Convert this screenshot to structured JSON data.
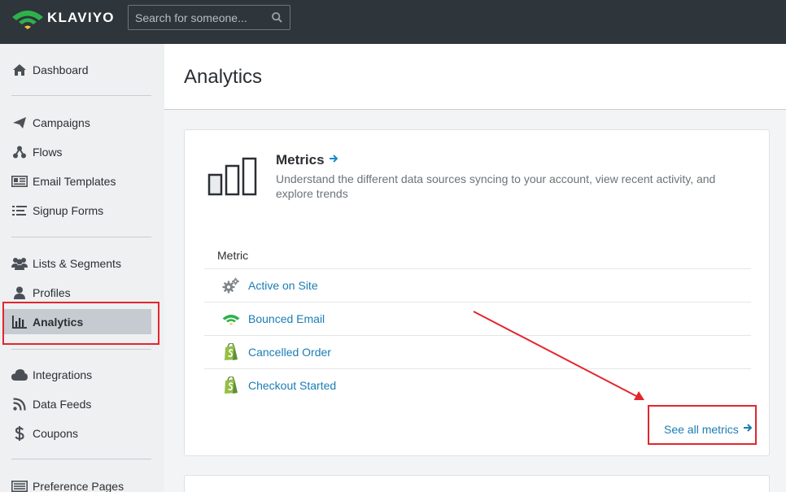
{
  "brand": {
    "name": "KLAVIYO",
    "accent": "#2cb24b"
  },
  "search": {
    "placeholder": "Search for someone..."
  },
  "sidebar": {
    "items": [
      {
        "label": "Dashboard",
        "icon": "home-icon"
      },
      {
        "label": "Campaigns",
        "icon": "paper-plane-icon"
      },
      {
        "label": "Flows",
        "icon": "flows-icon"
      },
      {
        "label": "Email Templates",
        "icon": "email-template-icon"
      },
      {
        "label": "Signup Forms",
        "icon": "list-form-icon"
      },
      {
        "label": "Lists & Segments",
        "icon": "users-icon"
      },
      {
        "label": "Profiles",
        "icon": "user-icon"
      },
      {
        "label": "Analytics",
        "icon": "bar-chart-icon",
        "active": true
      },
      {
        "label": "Integrations",
        "icon": "cloud-icon"
      },
      {
        "label": "Data Feeds",
        "icon": "rss-icon"
      },
      {
        "label": "Coupons",
        "icon": "dollar-icon"
      },
      {
        "label": "Preference Pages",
        "icon": "preference-page-icon"
      }
    ]
  },
  "main": {
    "title": "Analytics",
    "metrics_card": {
      "title": "Metrics",
      "description": "Understand the different data sources syncing to your account, view recent activity, and explore trends",
      "column_header": "Metric",
      "rows": [
        {
          "label": "Active on Site",
          "icon": "gears-icon"
        },
        {
          "label": "Bounced Email",
          "icon": "klaviyo-icon"
        },
        {
          "label": "Cancelled Order",
          "icon": "shopify-icon"
        },
        {
          "label": "Checkout Started",
          "icon": "shopify-icon"
        }
      ],
      "see_all_label": "See all metrics"
    }
  },
  "colors": {
    "link": "#1a7db5",
    "annotation": "#e3262e",
    "topbar": "#2e353b",
    "active_nav": "#c5cbd0"
  }
}
